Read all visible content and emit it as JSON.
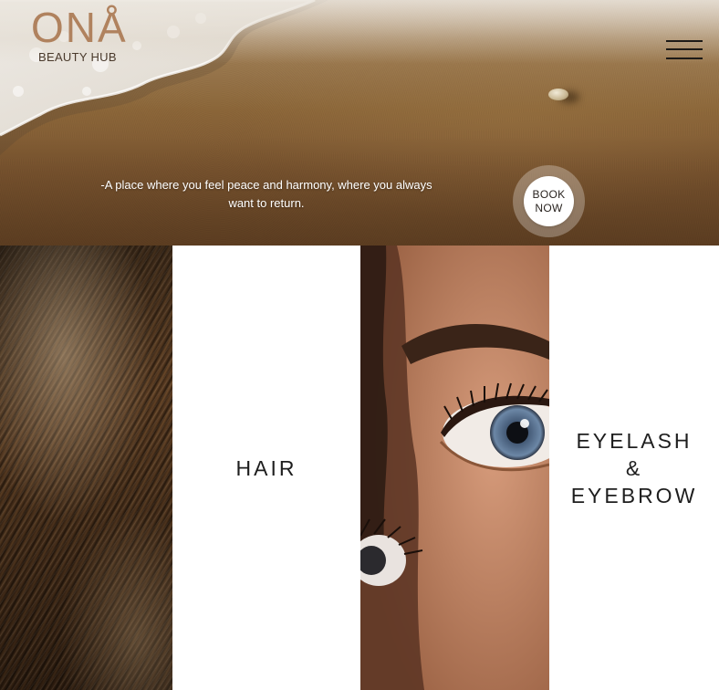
{
  "brand": {
    "logo_mark": "ONÅ",
    "logo_sub": "BEAUTY HUB",
    "accent_color": "#b0825e"
  },
  "header": {
    "menu_icon": "hamburger-icon"
  },
  "hero": {
    "tagline": "-A place where you feel peace and harmony, where you always want to return.",
    "book_button_label": "BOOK NOW"
  },
  "services": [
    {
      "title": "HAIR",
      "image": "hair-closeup-image"
    },
    {
      "title": "EYELASH & EYEBROW",
      "image": "eye-closeup-image"
    }
  ]
}
